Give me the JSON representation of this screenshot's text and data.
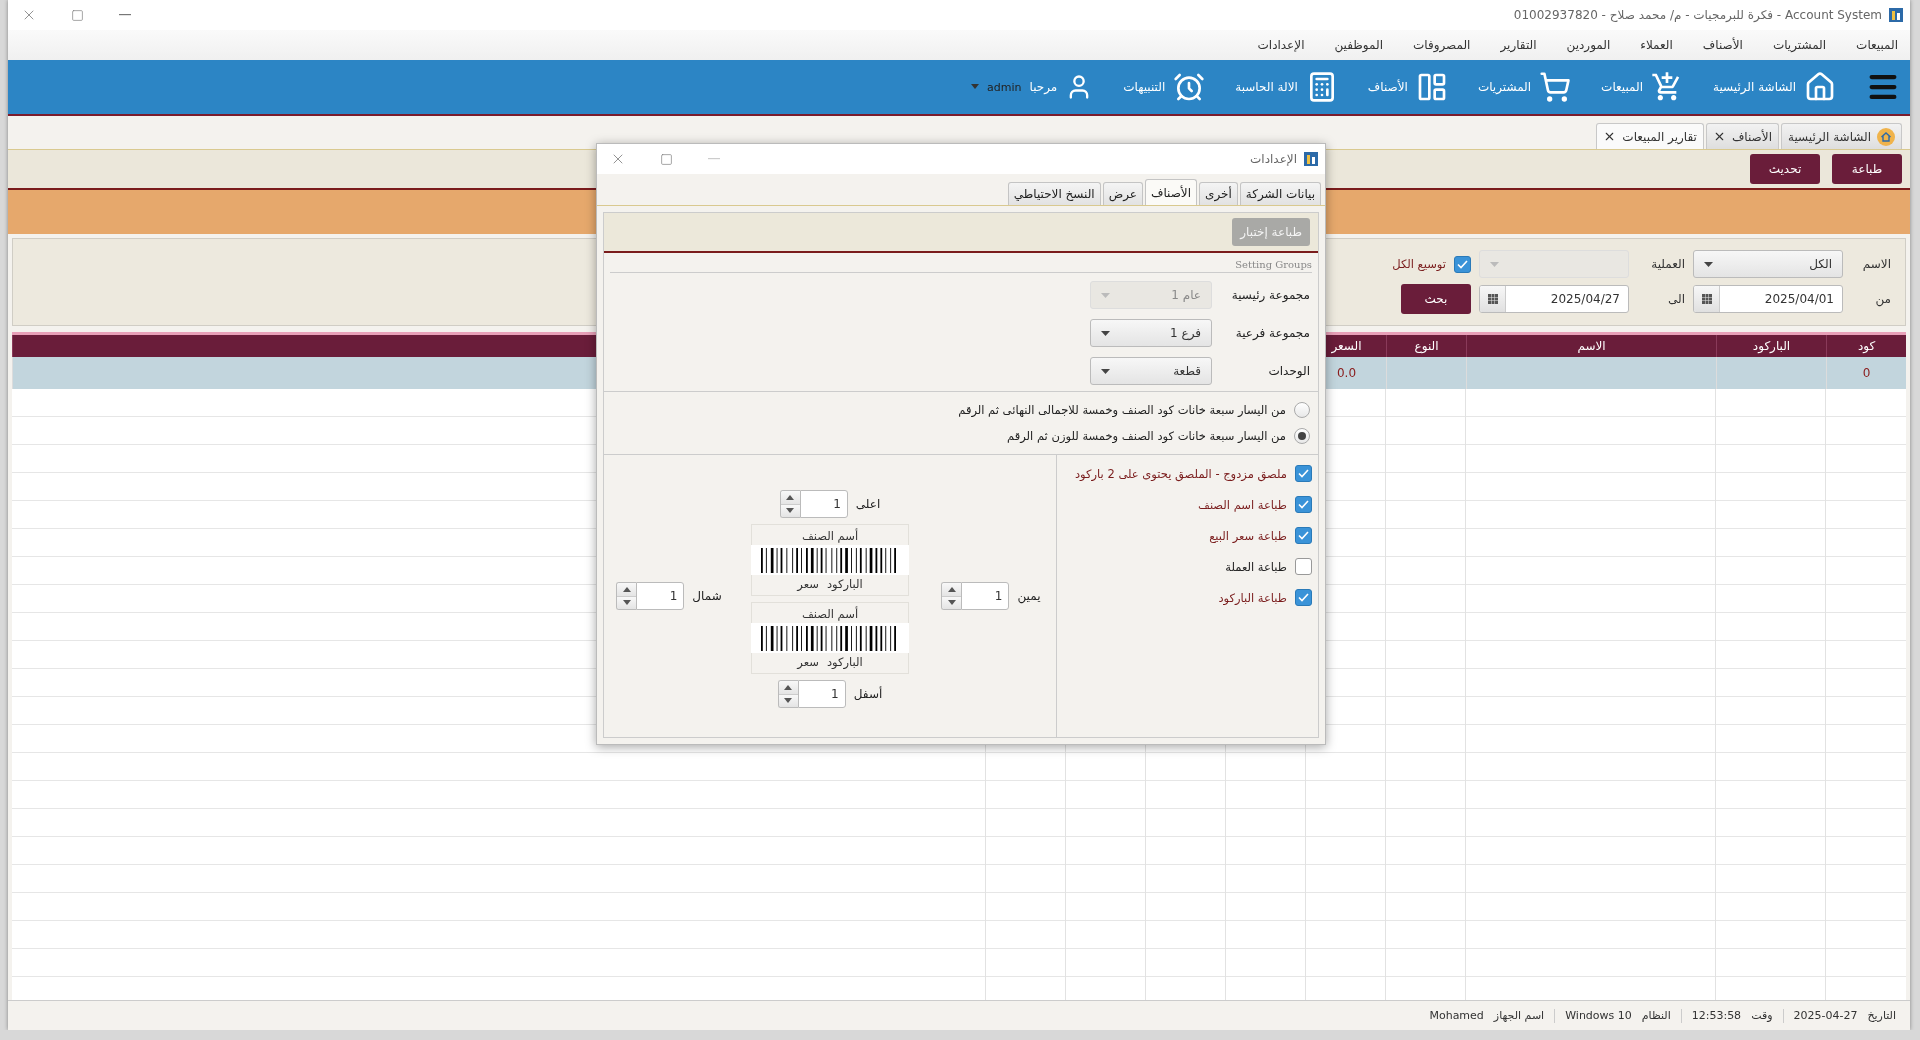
{
  "window": {
    "title": "Account System  - فكرة للبرمجيات - م/ محمد صلاح - 01002937820"
  },
  "menu": [
    "المبيعات",
    "المشتريات",
    "الأصناف",
    "العملاء",
    "الموردين",
    "التقارير",
    "المصروفات",
    "الموظفين",
    "الإعدادات"
  ],
  "toolbar": [
    "الشاشة الرئيسية",
    "المبيعات",
    "المشتريات",
    "الأصناف",
    "الالة الحاسبة",
    "التنبيهات"
  ],
  "user": {
    "greeting": "مرحبا",
    "name": "admin"
  },
  "doc_tabs": [
    {
      "label": "الشاشة الرئيسية",
      "closable": false,
      "selected": false
    },
    {
      "label": "الأصناف",
      "closable": true,
      "selected": false
    },
    {
      "label": "تقارير المبيعات",
      "closable": true,
      "selected": true
    }
  ],
  "actions": [
    "طباعة",
    "تحديث"
  ],
  "filters": {
    "name_label": "الاسم",
    "name_value": "الكل",
    "operation_label": "العملية",
    "operation_disabled": true,
    "expand_all": {
      "label": "توسيع الكل",
      "checked": true
    },
    "from_label": "من",
    "from_date": "2025/04/01",
    "to_label": "الى",
    "to_date": "2025/04/27",
    "search_button": "بحث"
  },
  "table": {
    "columns": [
      "كود",
      "الباركود",
      "الاسم",
      "النوع",
      "السعر"
    ],
    "rows": [
      {
        "selected": true,
        "cells": [
          "0",
          "",
          "",
          "",
          "0.0"
        ]
      }
    ]
  },
  "dialog": {
    "title": "الإعدادات",
    "tabs": [
      {
        "label": "بيانات الشركة",
        "selected": false
      },
      {
        "label": "أخرى",
        "selected": false
      },
      {
        "label": "الأصناف",
        "selected": true
      },
      {
        "label": "عرض",
        "selected": false
      },
      {
        "label": "النسخ الاحتياطي",
        "selected": false
      }
    ],
    "test_print": {
      "label": "طباعة إختبار",
      "disabled": true
    },
    "group_title": "Setting Groups",
    "fields": [
      {
        "label": "مجموعة رئيسية",
        "value": "عام 1",
        "disabled": true
      },
      {
        "label": "مجموعة فرعية",
        "value": "فرع 1",
        "disabled": false
      },
      {
        "label": "الوحدات",
        "value": "قطعة",
        "disabled": false
      }
    ],
    "barcode_formats": [
      {
        "label": "من اليسار سبعة خانات كود الصنف وخمسة للاجمالى النهائى ثم الرقم",
        "selected": false
      },
      {
        "label": "من اليسار سبعة خانات كود الصنف وخمسة للوزن ثم الرقم",
        "selected": true
      }
    ],
    "print_options": [
      {
        "label": "ملصق مزدوج - الملصق يحتوى على 2 باركود",
        "checked": true
      },
      {
        "label": "طباعة اسم الصنف",
        "checked": true
      },
      {
        "label": "طباعة سعر البيع",
        "checked": true
      },
      {
        "label": "طباعة العملة",
        "checked": false
      },
      {
        "label": "طباعة الباركود",
        "checked": true
      }
    ],
    "margins": {
      "top": {
        "label": "اعلى",
        "value": "1"
      },
      "right": {
        "label": "يمين",
        "value": "1"
      },
      "left": {
        "label": "شمال",
        "value": "1"
      },
      "bottom": {
        "label": "أسفل",
        "value": "1"
      }
    },
    "previews": [
      {
        "name": "أسم الصنف",
        "barcode": "الباركود",
        "price": "سعر"
      },
      {
        "name": "أسم الصنف",
        "barcode": "الباركود",
        "price": "سعر"
      }
    ]
  },
  "status_bar": [
    {
      "label": "التاريخ",
      "value": "2025-04-27"
    },
    {
      "label": "وقت",
      "value": "12:53:58"
    },
    {
      "label": "النظام",
      "value": "Windows 10"
    },
    {
      "label": "اسم الجهاز",
      "value": "Mohamed"
    }
  ]
}
